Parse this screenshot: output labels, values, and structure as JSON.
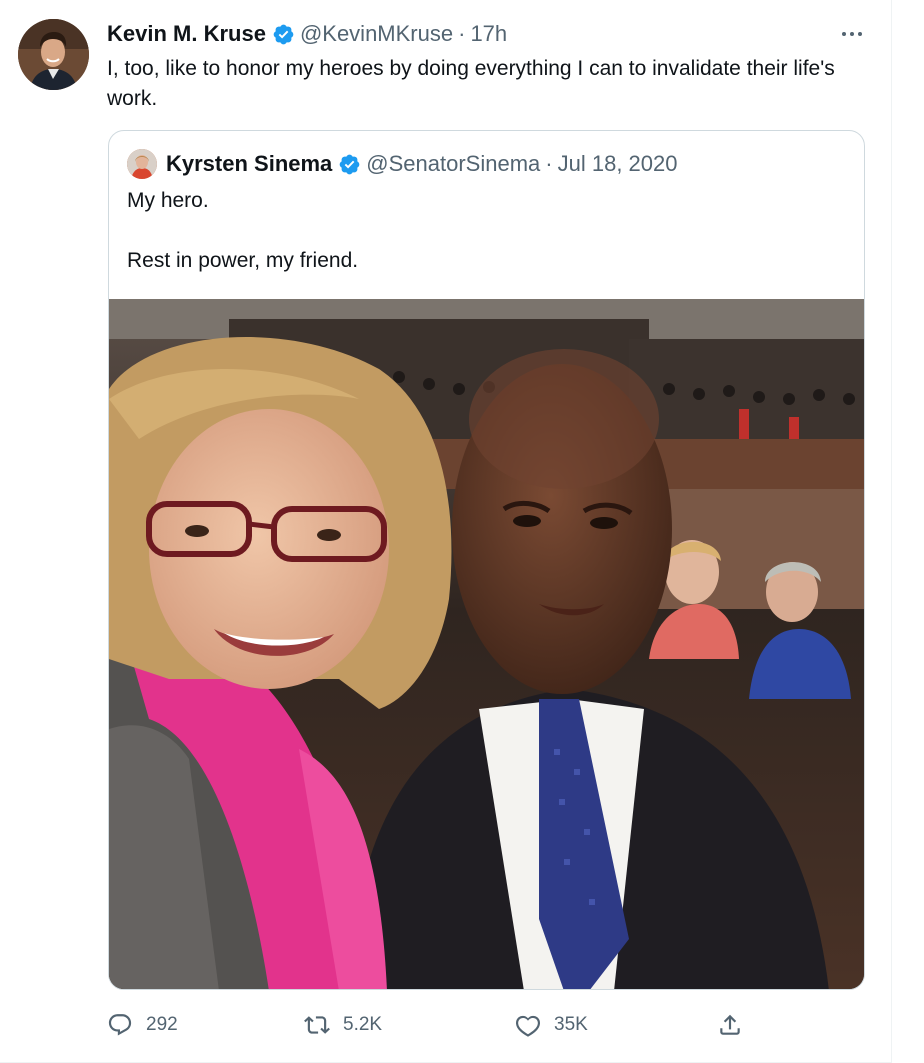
{
  "tweet": {
    "author_name": "Kevin M. Kruse",
    "author_handle": "@KevinMKruse",
    "time": "17h",
    "time_separator": "·",
    "text": "I, too, like to honor my heroes by doing everything I can to invalidate their life's work."
  },
  "quoted_tweet": {
    "author_name": "Kyrsten Sinema",
    "author_handle": "@SenatorSinema",
    "date_separator": "·",
    "date": "Jul 18, 2020",
    "text_line1": "My hero.",
    "text_line2": "Rest in power, my friend."
  },
  "actions": {
    "reply_count": "292",
    "retweet_count": "5.2K",
    "like_count": "35K"
  },
  "icons": [
    "verified-badge-icon",
    "more-options-icon",
    "reply-icon",
    "retweet-icon",
    "like-icon",
    "share-icon"
  ],
  "colors": {
    "verified_blue": "#1d9bf0",
    "text_primary": "#0f1419",
    "text_secondary": "#536471",
    "border": "#cfd9de"
  }
}
